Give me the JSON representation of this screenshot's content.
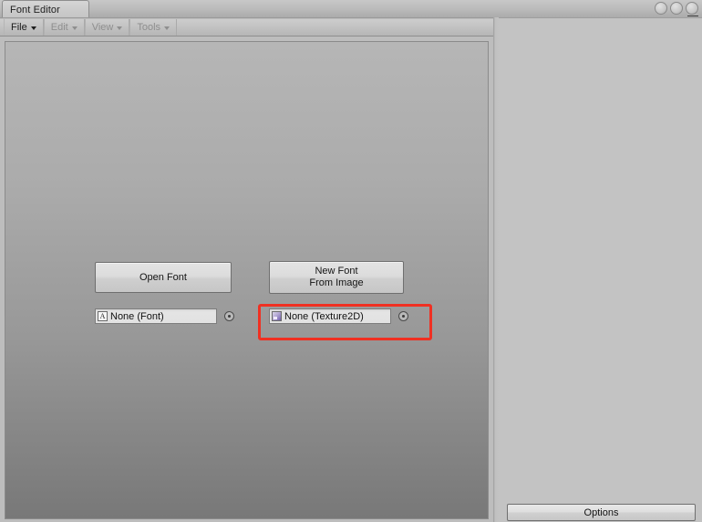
{
  "window": {
    "tab_label": "Font Editor",
    "controls": [
      "minimize-circle",
      "maximize-circle",
      "close-circle"
    ],
    "menu_icon": "hamburger-menu-icon"
  },
  "menubar": {
    "items": [
      {
        "label": "File",
        "enabled": true,
        "caret": "chevron-down-icon"
      },
      {
        "label": "Edit",
        "enabled": false,
        "caret": "chevron-down-icon"
      },
      {
        "label": "View",
        "enabled": false,
        "caret": "chevron-down-icon"
      },
      {
        "label": "Tools",
        "enabled": false,
        "caret": "chevron-down-icon"
      }
    ]
  },
  "main": {
    "open_font_button": "Open Font",
    "new_font_button_line1": "New Font",
    "new_font_button_line2": "From Image",
    "font_field": {
      "value": "None (Font)",
      "icon": "font-asset-icon",
      "picker": "object-picker-icon"
    },
    "texture_field": {
      "value": "None (Texture2D)",
      "icon": "texture2d-asset-icon",
      "picker": "object-picker-icon"
    },
    "highlight_color": "#f03022"
  },
  "right_panel": {
    "options_button": "Options"
  }
}
